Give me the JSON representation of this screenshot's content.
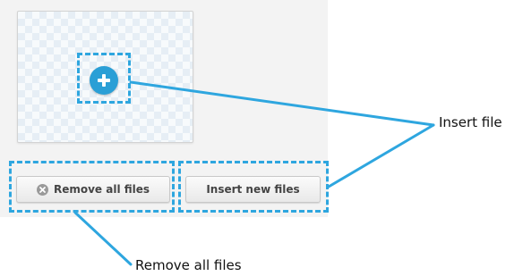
{
  "uploader": {
    "add_button_icon": "plus-circle-icon",
    "remove_button": {
      "icon": "x-circle-icon",
      "label": "Remove all files"
    },
    "insert_button": {
      "label": "Insert new files"
    }
  },
  "callouts": {
    "insert_file": "Insert file",
    "remove_all_files": "Remove all files"
  },
  "colors": {
    "highlight": "#2ea6df",
    "add_button": "#2a9fd6",
    "panel_background": "#f3f3f3"
  }
}
